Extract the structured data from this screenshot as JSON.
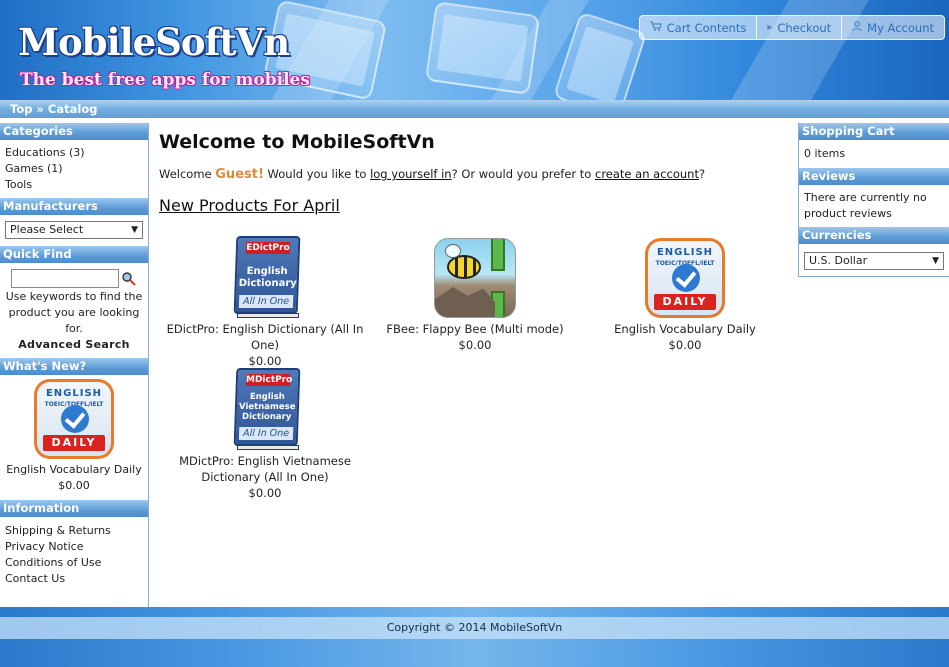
{
  "header": {
    "logo_title": "MobileSoftVn",
    "logo_tagline": "The best free apps for mobiles",
    "nav": [
      {
        "label": "Cart Contents",
        "icon": "cart-icon"
      },
      {
        "label": "Checkout",
        "icon": "arrow-right-icon"
      },
      {
        "label": "My Account",
        "icon": "user-icon"
      }
    ]
  },
  "breadcrumb": {
    "top": "Top",
    "sep": "»",
    "catalog": "Catalog"
  },
  "left": {
    "categories": {
      "title": "Categories",
      "items": [
        "Educations (3)",
        "Games (1)",
        "Tools"
      ]
    },
    "manufacturers": {
      "title": "Manufacturers",
      "selected": "Please Select"
    },
    "quickfind": {
      "title": "Quick Find",
      "help": "Use keywords to find the product you are looking for.",
      "advanced": "Advanced Search"
    },
    "whatsnew": {
      "title": "What's New?",
      "product_name": "English Vocabulary Daily",
      "price": "$0.00"
    },
    "information": {
      "title": "Information",
      "items": [
        "Shipping & Returns",
        "Privacy Notice",
        "Conditions of Use",
        "Contact Us"
      ]
    }
  },
  "main": {
    "title": "Welcome to MobileSoftVn",
    "welcome_prefix": "Welcome",
    "guest": "Guest!",
    "welcome_mid": "Would you like to",
    "login_link": "log yourself in",
    "welcome_mid2": "? Or would you prefer to",
    "create_link": "create an account",
    "welcome_end": "?",
    "new_products_title": "New Products For April",
    "products": [
      {
        "name": "EDictPro: English Dictionary (All In One)",
        "price": "$0.00",
        "icon": "edictpro-icon"
      },
      {
        "name": "FBee: Flappy Bee (Multi mode)",
        "price": "$0.00",
        "icon": "flappy-bee-icon"
      },
      {
        "name": "English Vocabulary Daily",
        "price": "$0.00",
        "icon": "vocabulary-icon"
      },
      {
        "name": "MDictPro: English Vietnamese Dictionary (All In One)",
        "price": "$0.00",
        "icon": "mdictpro-icon"
      }
    ]
  },
  "icon_text": {
    "vocab_line1": "ENGLISH",
    "vocab_line2": "TOEIC/TOEFL/IELT",
    "vocab_band": "DAILY",
    "edict_label": "EDictPro",
    "edict_title": "English Dictionary",
    "mdict_label": "MDictPro",
    "mdict_title": "English Vietnamese Dictionary",
    "allinone": "All In One"
  },
  "right": {
    "cart": {
      "title": "Shopping Cart",
      "text": "0 items"
    },
    "reviews": {
      "title": "Reviews",
      "text": "There are currently no product reviews"
    },
    "currencies": {
      "title": "Currencies",
      "selected": "U.S. Dollar"
    }
  },
  "footer": {
    "copyright": "Copyright © 2014 MobileSoftVn"
  },
  "colors": {
    "accent": "#5d9bd6",
    "guest": "#e08a3c"
  }
}
